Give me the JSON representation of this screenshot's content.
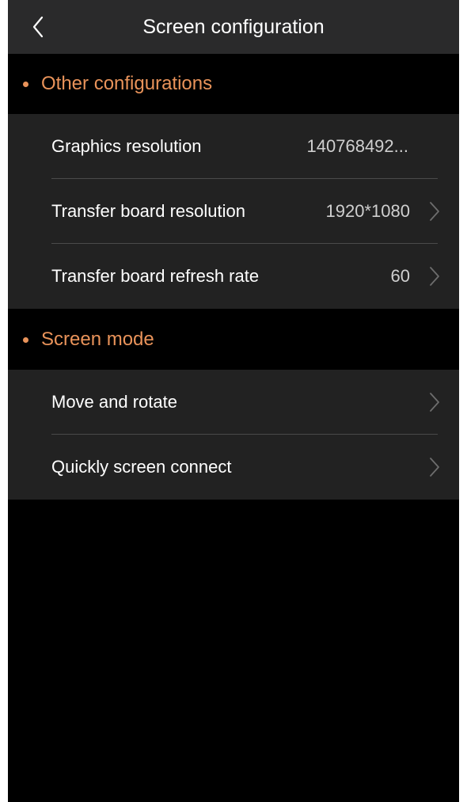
{
  "header": {
    "title": "Screen configuration",
    "back_icon": "chevron-left-icon"
  },
  "colors": {
    "accent": "#e9935a",
    "background": "#000000",
    "nav_bar": "#2a2a2b",
    "group_background": "#222222",
    "text": "#ffffff",
    "value_text": "#cfcfcf"
  },
  "sections": [
    {
      "title": "Other configurations",
      "rows": [
        {
          "label": "Graphics resolution",
          "value": "140768492..."
        },
        {
          "label": "Transfer board resolution",
          "value": "1920*1080",
          "chevron": "chevron-right-icon"
        },
        {
          "label": "Transfer board refresh rate",
          "value": "60",
          "chevron": "chevron-right-icon"
        }
      ]
    },
    {
      "title": "Screen mode",
      "rows": [
        {
          "label": "Move and rotate",
          "chevron": "chevron-right-icon"
        },
        {
          "label": "Quickly screen connect",
          "chevron": "chevron-right-icon"
        }
      ]
    }
  ]
}
